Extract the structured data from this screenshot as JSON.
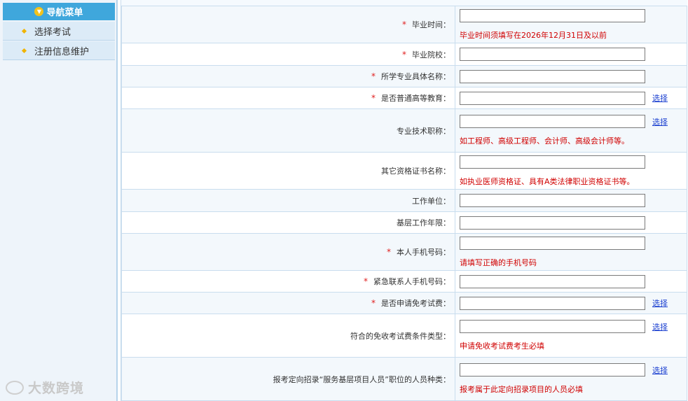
{
  "sidebar": {
    "header": "导航菜单",
    "items": [
      {
        "label": "选择考试"
      },
      {
        "label": "注册信息维护"
      }
    ]
  },
  "watermark": "大数跨境",
  "form": {
    "select_label": "选择",
    "rows": [
      {
        "label": "毕业时间：",
        "required": true,
        "hint": "毕业时间须填写在2026年12月31日及以前"
      },
      {
        "label": "毕业院校：",
        "required": true
      },
      {
        "label": "所学专业具体名称：",
        "required": true
      },
      {
        "label": "是否普通高等教育：",
        "required": true,
        "select": true
      },
      {
        "label": "专业技术职称：",
        "required": false,
        "select": true,
        "hint": "如工程师、高级工程师、会计师、高级会计师等。"
      },
      {
        "label": "其它资格证书名称：",
        "required": false,
        "hint": "如执业医师资格证、具有A类法律职业资格证书等。"
      },
      {
        "label": "工作单位：",
        "required": false
      },
      {
        "label": "基层工作年限：",
        "required": false
      },
      {
        "label": "本人手机号码：",
        "required": true,
        "hint": "请填写正确的手机号码"
      },
      {
        "label": "紧急联系人手机号码：",
        "required": true
      },
      {
        "label": "是否申请免考试费：",
        "required": true,
        "select": true
      },
      {
        "label": "符合的免收考试费条件类型：",
        "required": false,
        "select": true,
        "hint": "申请免收考试费考生必填"
      },
      {
        "label": "报考定向招录“服务基层项目人员”职位的人员种类：",
        "required": false,
        "select": true,
        "hint": "报考属于此定向招录项目的人员必填"
      }
    ]
  }
}
